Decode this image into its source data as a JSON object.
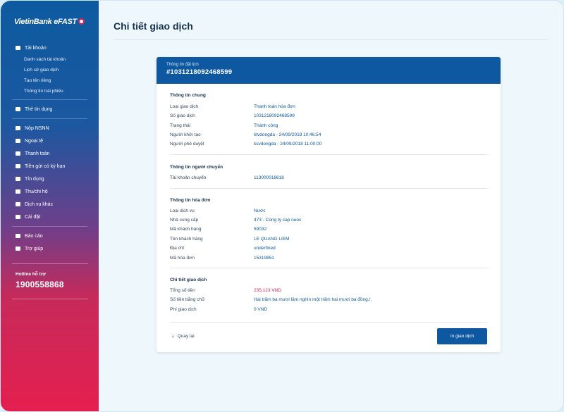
{
  "brand": {
    "logo_text": "VietinBank eFAST"
  },
  "sidebar": {
    "account": {
      "label": "Tài khoản",
      "subs": [
        "Danh sách tài khoản",
        "Lịch sử giao dịch",
        "Tạo tên riêng",
        "Thông tin trái phiếu"
      ]
    },
    "credit": "Thẻ tín dụng",
    "items": [
      "Nộp NSNN",
      "Ngoại tệ",
      "Thanh toán",
      "Tiền gửi có kỳ hạn",
      "Tín dụng",
      "Thu/chi hộ",
      "Dịch vụ khác",
      "Cài đặt"
    ],
    "items2": [
      "Báo cáo",
      "Trợ giúp"
    ],
    "hotline_label": "Hotline hỗ trợ",
    "hotline_number": "1900558868"
  },
  "page": {
    "title": "Chi tiết giao dịch"
  },
  "card": {
    "head_label": "Thông tin đặt lịch",
    "transaction_id": "#1031218092468599",
    "general": {
      "title": "Thông tin chung",
      "rows": [
        {
          "k": "Loại giao dịch",
          "v": "Thanh toán hóa đơn"
        },
        {
          "k": "Số giao dịch",
          "v": "1031218092468599"
        },
        {
          "k": "Trạng thái",
          "v": "Thành công"
        },
        {
          "k": "Người khởi tạo",
          "v": "ktvdongda - 24/09/2018 10:46:54"
        },
        {
          "k": "Người phê duyệt",
          "v": "ksvdongda - 24/09/2018 11:00:00"
        }
      ]
    },
    "sender": {
      "title": "Thông tin người chuyển",
      "rows": [
        {
          "k": "Tài khoản chuyển",
          "v": "113000018618"
        }
      ]
    },
    "bill": {
      "title": "Thông tin hóa đơn",
      "rows": [
        {
          "k": "Loại dịch vụ",
          "v": "Nước"
        },
        {
          "k": "Nhà cung cấp",
          "v": "473 - Cong ty cap nuoc"
        },
        {
          "k": "Mã khách hàng",
          "v": "59032"
        },
        {
          "k": "Tên khách hàng",
          "v": "LE QUANG LIEM"
        },
        {
          "k": "Địa chỉ",
          "v": "underfined"
        },
        {
          "k": "Mã hóa đơn",
          "v": "15319851"
        }
      ]
    },
    "detail": {
      "title": "Chi tiết giao dịch",
      "rows": [
        {
          "k": "Tổng số tiền",
          "v": "235,123 VND"
        },
        {
          "k": "Số tiền bằng chữ",
          "v": "Hai trăm ba mươi lăm nghìn một trăm hai mươi ba đồng./."
        },
        {
          "k": "Phí giao dịch",
          "v": "0 VND"
        }
      ]
    },
    "back_label": "Quay lại",
    "print_label": "In giao dịch"
  },
  "colors": {
    "primary": "#0d58a0",
    "accent": "#e51f4f"
  }
}
